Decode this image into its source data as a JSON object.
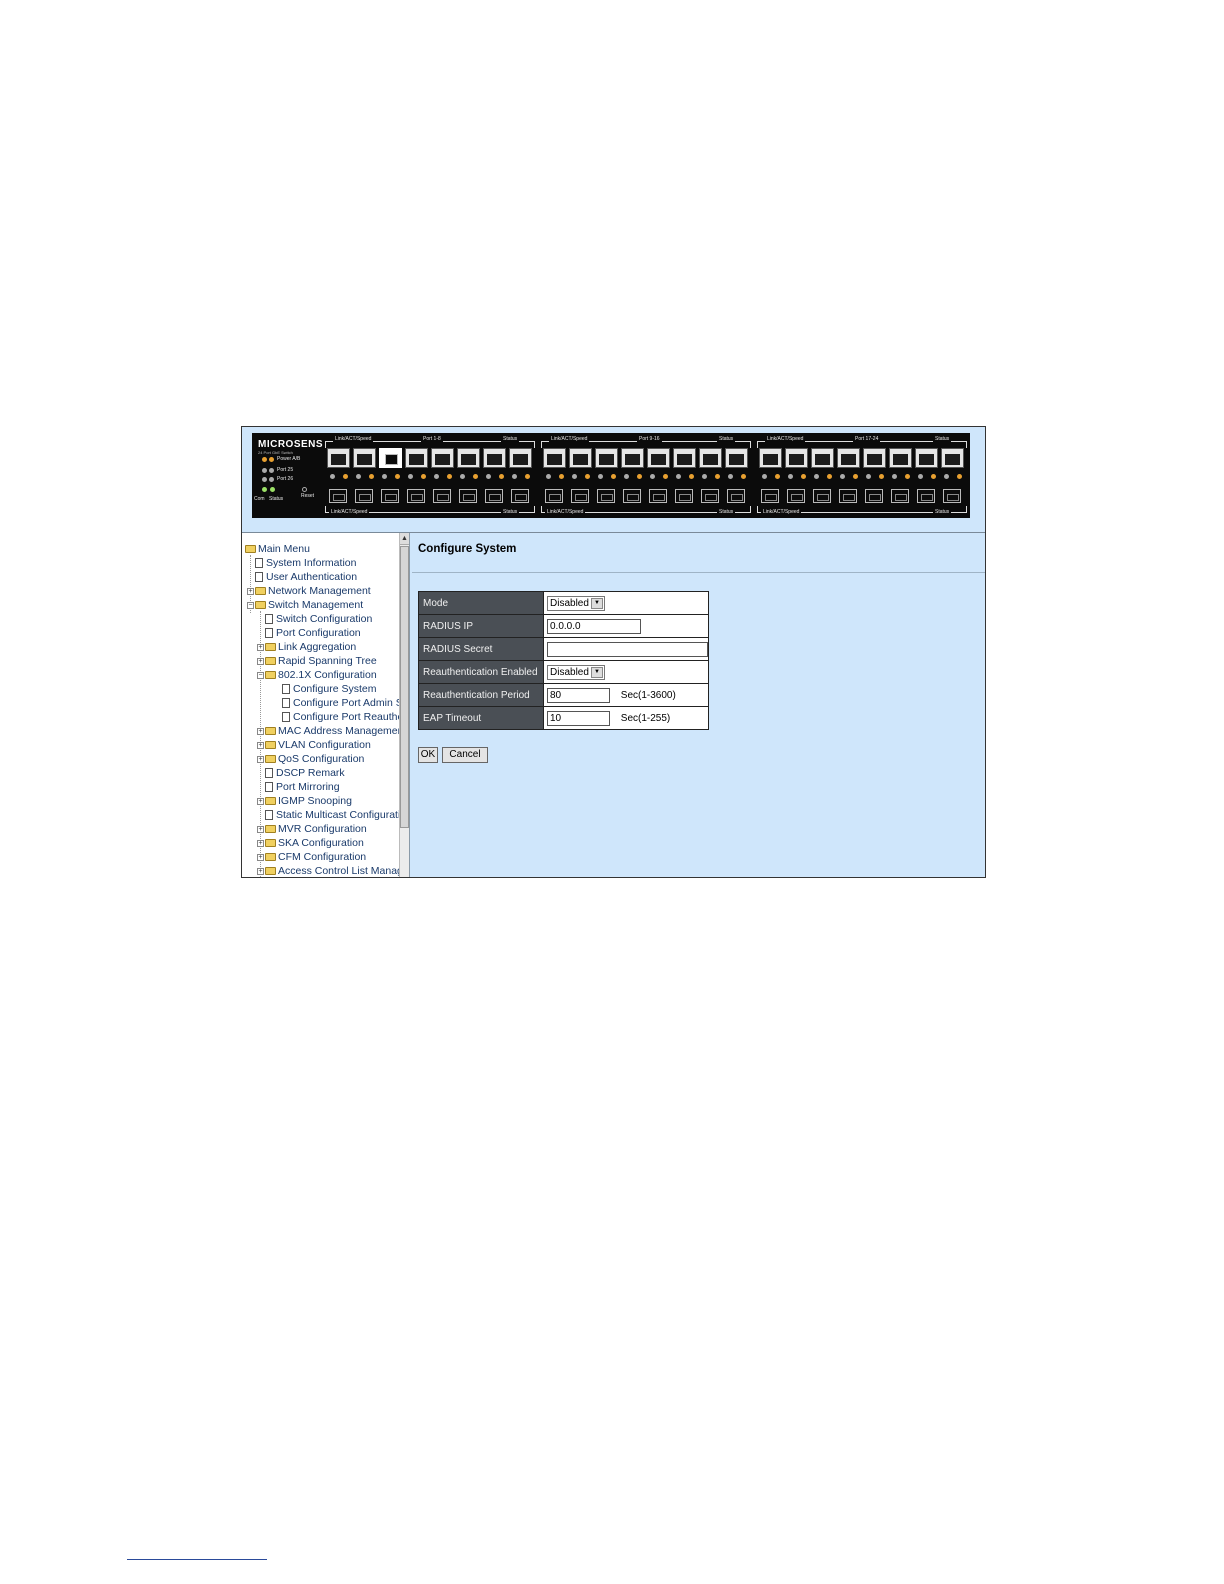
{
  "device": {
    "brand": "MICROSENS",
    "model": "24 Port GbE Switch",
    "labels": {
      "power": "Power A/B",
      "port25": "Port 25",
      "port26": "Port 26",
      "com": "Com",
      "status": "Status",
      "reset": "Reset"
    },
    "groups": [
      {
        "top_left": "Link/ACT/Speed",
        "center": "Port 1-8",
        "top_right": "Status",
        "bottom_left": "Link/ACT/Speed",
        "bottom_right": "Status"
      },
      {
        "top_left": "Link/ACT/Speed",
        "center": "Port 9-16",
        "top_right": "Status",
        "bottom_left": "Link/ACT/Speed",
        "bottom_right": "Status"
      },
      {
        "top_left": "Link/ACT/Speed",
        "center": "Port 17-24",
        "top_right": "Status",
        "bottom_left": "Link/ACT/Speed",
        "bottom_right": "Status"
      }
    ]
  },
  "sidebar": {
    "items": [
      {
        "label": "Main Menu",
        "type": "folder-open"
      },
      {
        "label": "System Information",
        "type": "doc"
      },
      {
        "label": "User Authentication",
        "type": "doc"
      },
      {
        "label": "Network Management",
        "type": "folder"
      },
      {
        "label": "Switch Management",
        "type": "folder-open"
      },
      {
        "label": "Switch Configuration",
        "type": "doc"
      },
      {
        "label": "Port Configuration",
        "type": "doc"
      },
      {
        "label": "Link Aggregation",
        "type": "folder"
      },
      {
        "label": "Rapid Spanning Tree",
        "type": "folder"
      },
      {
        "label": "802.1X Configuration",
        "type": "folder-open"
      },
      {
        "label": "Configure System",
        "type": "doc"
      },
      {
        "label": "Configure Port Admin Sta",
        "type": "doc"
      },
      {
        "label": "Configure Port Reauthent",
        "type": "doc"
      },
      {
        "label": "MAC Address Managemen",
        "type": "folder"
      },
      {
        "label": "VLAN Configuration",
        "type": "folder"
      },
      {
        "label": "QoS Configuration",
        "type": "folder"
      },
      {
        "label": "DSCP Remark",
        "type": "doc"
      },
      {
        "label": "Port Mirroring",
        "type": "doc"
      },
      {
        "label": "IGMP Snooping",
        "type": "folder"
      },
      {
        "label": "Static Multicast Configuratio",
        "type": "doc"
      },
      {
        "label": "MVR Configuration",
        "type": "folder"
      },
      {
        "label": "SKA Configuration",
        "type": "folder"
      },
      {
        "label": "CFM Configuration",
        "type": "folder"
      },
      {
        "label": "Access Control List Manage",
        "type": "folder"
      }
    ]
  },
  "main": {
    "title": "Configure System",
    "form": {
      "mode": {
        "label": "Mode",
        "value": "Disabled"
      },
      "radius_ip": {
        "label": "RADIUS IP",
        "value": "0.0.0.0"
      },
      "radius_secret": {
        "label": "RADIUS Secret",
        "value": ""
      },
      "reauth_enabled": {
        "label": "Reauthentication Enabled",
        "value": "Disabled"
      },
      "reauth_period": {
        "label": "Reauthentication Period",
        "value": "80",
        "hint": "Sec(1-3600)"
      },
      "eap_timeout": {
        "label": "EAP Timeout",
        "value": "10",
        "hint": "Sec(1-255)"
      }
    },
    "buttons": {
      "ok": "OK",
      "cancel": "Cancel"
    }
  },
  "colors": {
    "content_bg": "#cfe6fb",
    "label_cell_bg": "#4a4f55",
    "device_bg": "#0b0b0b",
    "led_amber": "#e8a030"
  }
}
